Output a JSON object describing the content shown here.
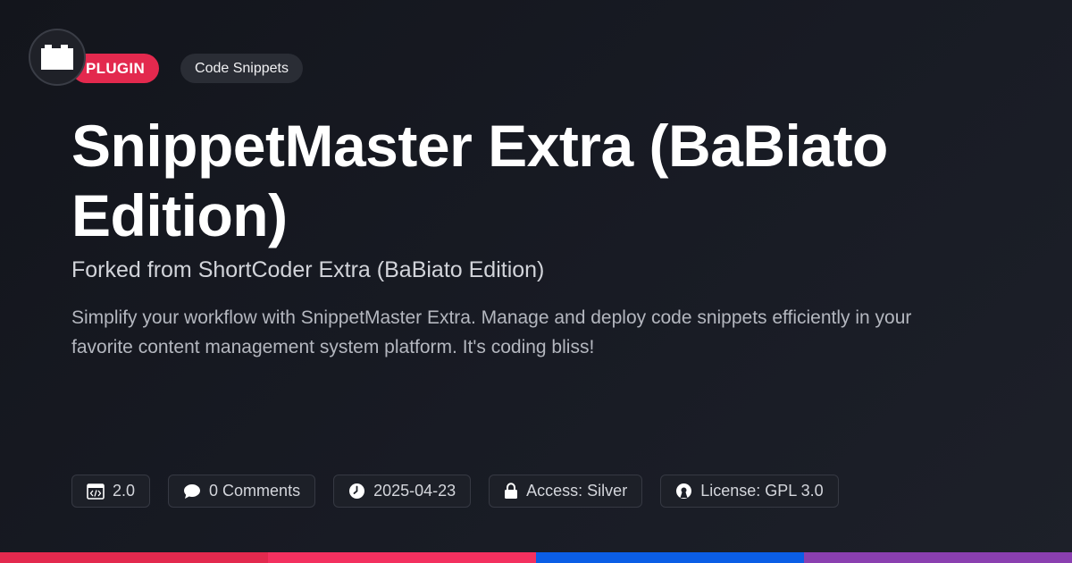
{
  "tags": {
    "type": "PLUGIN",
    "category": "Code Snippets"
  },
  "title": "SnippetMaster Extra (BaBiato Edition)",
  "subtitle": "Forked from ShortCoder Extra (BaBiato Edition)",
  "description": "Simplify your workflow with SnippetMaster Extra. Manage and deploy code snippets efficiently in your favorite content management system platform. It's coding bliss!",
  "meta": {
    "version": "2.0",
    "comments": "0 Comments",
    "date": "2025-04-23",
    "access": "Access: Silver",
    "license": "License: GPL 3.0"
  },
  "icons": [
    "logo-icon",
    "code-window-icon",
    "comment-icon",
    "clock-icon",
    "lock-icon",
    "open-source-icon"
  ],
  "colors": {
    "accent": "#e3294e",
    "bar": [
      "#e3294e",
      "#f3305f",
      "#0b5ee6",
      "#8a3fb0"
    ]
  }
}
